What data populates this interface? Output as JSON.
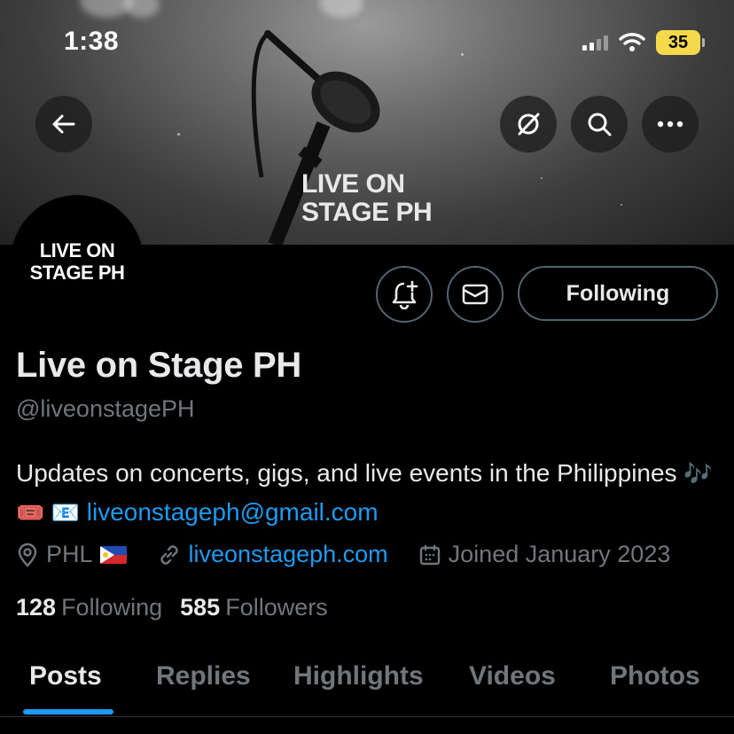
{
  "status_bar": {
    "time": "1:38",
    "battery": "35"
  },
  "banner": {
    "logo_line1": "LIVE ON",
    "logo_line2": "STAGE PH"
  },
  "avatar": {
    "line1": "LIVE ON",
    "line2": "STAGE PH"
  },
  "actions": {
    "following_label": "Following"
  },
  "profile": {
    "name": "Live on Stage PH",
    "handle": "@liveonstagePH",
    "bio_text": "Updates on concerts, gigs, and live events in the Philippines",
    "bio_emojis": "🎶🎟️ 📧",
    "bio_email": "liveonstageph@gmail.com",
    "location": "PHL",
    "website": "liveonstageph.com",
    "joined": "Joined January 2023"
  },
  "stats": {
    "following_count": "128",
    "following_label": "Following",
    "followers_count": "585",
    "followers_label": "Followers"
  },
  "tabs": [
    {
      "label": "Posts"
    },
    {
      "label": "Replies"
    },
    {
      "label": "Highlights"
    },
    {
      "label": "Videos"
    },
    {
      "label": "Photos"
    }
  ],
  "colors": {
    "accent": "#1d9bf0",
    "battery": "#f5d94a"
  }
}
